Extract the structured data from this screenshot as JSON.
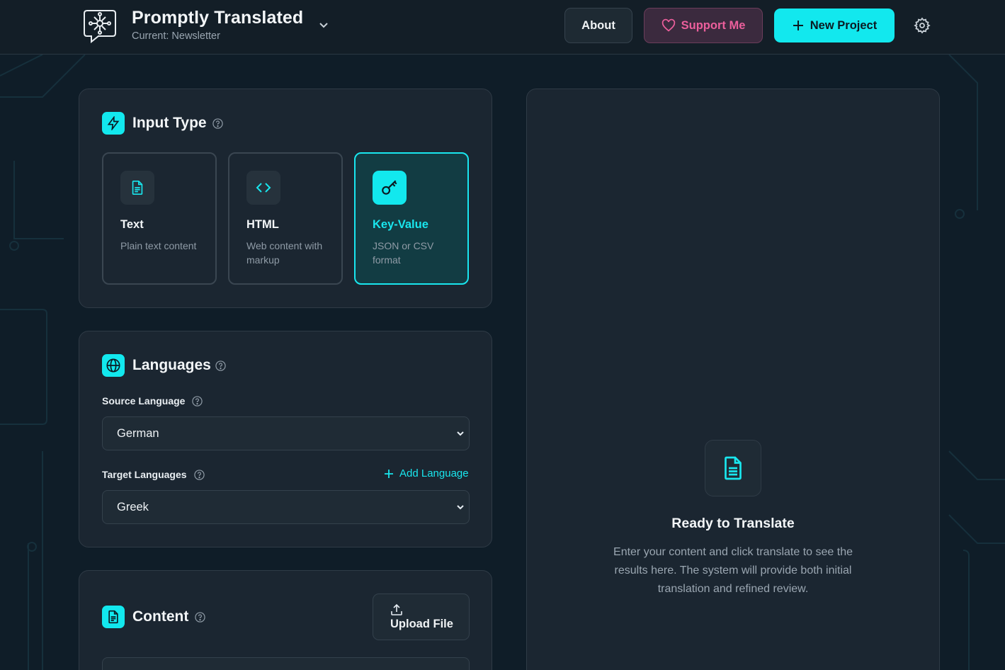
{
  "colors": {
    "accent": "#12e8ee",
    "support": "#ec5f9c",
    "background": "#0f1d28",
    "card": "#1b2631"
  },
  "header": {
    "title": "Promptly Translated",
    "subtitle": "Current: Newsletter",
    "about_label": "About",
    "support_label": "Support Me",
    "new_project_label": "New Project",
    "icons": [
      "brain-circuit-logo",
      "chevron-down-icon",
      "heart-icon",
      "plus-icon",
      "gear-icon"
    ]
  },
  "input_type": {
    "title": "Input Type",
    "options": [
      {
        "name": "Text",
        "description": "Plain text content",
        "icon": "file-text-icon",
        "selected": false
      },
      {
        "name": "HTML",
        "description": "Web content with markup",
        "icon": "code-icon",
        "selected": false
      },
      {
        "name": "Key-Value",
        "description": "JSON or CSV format",
        "icon": "key-icon",
        "selected": true
      }
    ]
  },
  "languages": {
    "title": "Languages",
    "source_label": "Source Language",
    "source_value": "German",
    "target_label": "Target Languages",
    "add_language_label": "Add Language",
    "target_value": "Greek"
  },
  "content": {
    "title": "Content",
    "upload_label": "Upload File"
  },
  "result": {
    "title": "Ready to Translate",
    "description": "Enter your content and click translate to see the results here. The system will provide both initial translation and refined review."
  }
}
